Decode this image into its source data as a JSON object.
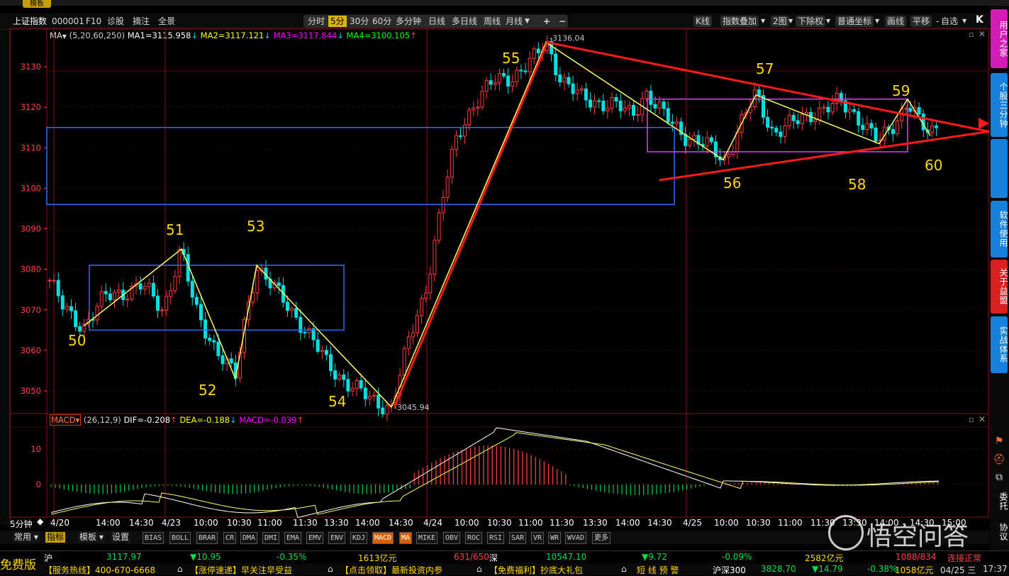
{
  "app": {
    "top_button": "模板",
    "index_name": "上证指数",
    "index_code": "000001",
    "menu": [
      "F10",
      "诊股",
      "摘注",
      "全景"
    ],
    "periods": [
      "分时",
      "5分",
      "30分",
      "60分",
      "多分钟",
      "日线",
      "多日线",
      "周线",
      "月线"
    ],
    "period_selected": "5分",
    "zoom_plus": "+",
    "zoom_minus": "−",
    "right_tools": [
      "K线",
      "指数叠加",
      "2图",
      "下除权",
      "普通坐标",
      "画线",
      "平移",
      "自选"
    ],
    "k_logo": "K"
  },
  "ma_line": {
    "label": "MA",
    "params": "(5,20,60,250)",
    "ma1": "MA1=3115.958",
    "ma2": "MA2=3117.121",
    "ma3": "MA3=3117.844",
    "ma4": "MA4=3100.105"
  },
  "macd_line": {
    "label": "MACD",
    "params": "(26,12,9)",
    "dif": "DIF=-0.208",
    "dea": "DEA=-0.188",
    "macd": "MACD=-0.039"
  },
  "right_sidebar": [
    "用户之家",
    "个股三分钟",
    "",
    "软件使用",
    "关于益盟",
    "实战体系",
    "委托",
    "协议"
  ],
  "bottom_tabs": [
    "常用",
    "指标",
    "模板",
    "设置",
    "BIAS",
    "BOLL",
    "BRAR",
    "CR",
    "DMA",
    "DMI",
    "EMA",
    "EMV",
    "ENV",
    "KDJ",
    "MACD",
    "MA",
    "MIKE",
    "OBV",
    "ROC",
    "RSI",
    "SAR",
    "VR",
    "WR",
    "WVAD",
    "更多"
  ],
  "bottom_tab_selected": [
    "指标",
    "MACD",
    "MA"
  ],
  "quote_bar": {
    "sh_label": "沪",
    "sh_price": "3117.97",
    "sh_change": "▼10.95",
    "sh_pct": "-0.35%",
    "sh_amount": "1613亿元",
    "sh_ratio": "631/650",
    "sz_label": "深",
    "sz_price": "10547.10",
    "sz_change": "▼9.72",
    "sz_pct": "-0.09%",
    "sz_amount": "2582亿元",
    "sz_ratio": "1088/834",
    "conn": "连接正常"
  },
  "ticker_bar": {
    "free": "免费版",
    "items": [
      "【服务热线】400-670-6668",
      "【涨停速递】早关注早受益",
      "【点击领取】最新投资内参",
      "【免费福利】抄底大礼包"
    ],
    "alert": "短 线 预 警",
    "hs300_label": "沪深300",
    "hs300_price": "3828.70",
    "hs300_change": "▼14.79",
    "hs300_pct": "-0.38%",
    "hs300_amount": "1058亿元",
    "date": "04/25 三",
    "time": "17:37"
  },
  "watermark": "悟空问答",
  "colors": {
    "up": "#ff3c3c",
    "down": "#00e0e0",
    "ma1": "#ffffff",
    "ma2": "#ffff00",
    "ma3": "#ff00ff",
    "ma4": "#00ff00",
    "box_blue": "#2a6cff",
    "box_magenta": "#e040ff",
    "trend_red": "#ff1a1a",
    "wave_yellow": "#ffff60",
    "wave_label": "#ffd700",
    "axis_text": "#ff4040"
  },
  "chart_data": {
    "type": "candlestick",
    "title": "上证指数 5分",
    "y_axis_ticks": [
      3050,
      3060,
      3070,
      3080,
      3090,
      3100,
      3110,
      3120,
      3130
    ],
    "ylim": [
      3044,
      3138
    ],
    "x_labels": [
      "4/20",
      "14:00",
      "14:30",
      "4/23",
      "10:00",
      "10:30",
      "11:00",
      "11:30",
      "13:30",
      "14:00",
      "14:30",
      "4/24",
      "10:00",
      "10:30",
      "11:00",
      "11:30",
      "13:30",
      "14:00",
      "14:30",
      "4/25",
      "10:00",
      "10:30",
      "11:00",
      "11:30",
      "13:30",
      "14:00",
      "14:30",
      "15:00"
    ],
    "high_mark": "3136.04",
    "low_mark": "3045.94",
    "wave_labels": [
      {
        "label": "50",
        "price": 3066
      },
      {
        "label": "51",
        "price": 3085
      },
      {
        "label": "52",
        "price": 3053
      },
      {
        "label": "53",
        "price": 3081
      },
      {
        "label": "54",
        "price": 3046
      },
      {
        "label": "55",
        "price": 3136
      },
      {
        "label": "56",
        "price": 3107
      },
      {
        "label": "57",
        "price": 3123
      },
      {
        "label": "58",
        "price": 3111
      },
      {
        "label": "59",
        "price": 3122
      },
      {
        "label": "60",
        "price": 3113
      }
    ],
    "boxes": [
      {
        "color": "blue",
        "price_top": 3081,
        "price_bottom": 3065
      },
      {
        "color": "blue",
        "price_top": 3115,
        "price_bottom": 3096
      },
      {
        "color": "magenta",
        "price_top": 3122,
        "price_bottom": 3109
      }
    ],
    "macd_ticks": [
      10,
      0
    ],
    "macd_ylim": [
      -8,
      15
    ]
  }
}
